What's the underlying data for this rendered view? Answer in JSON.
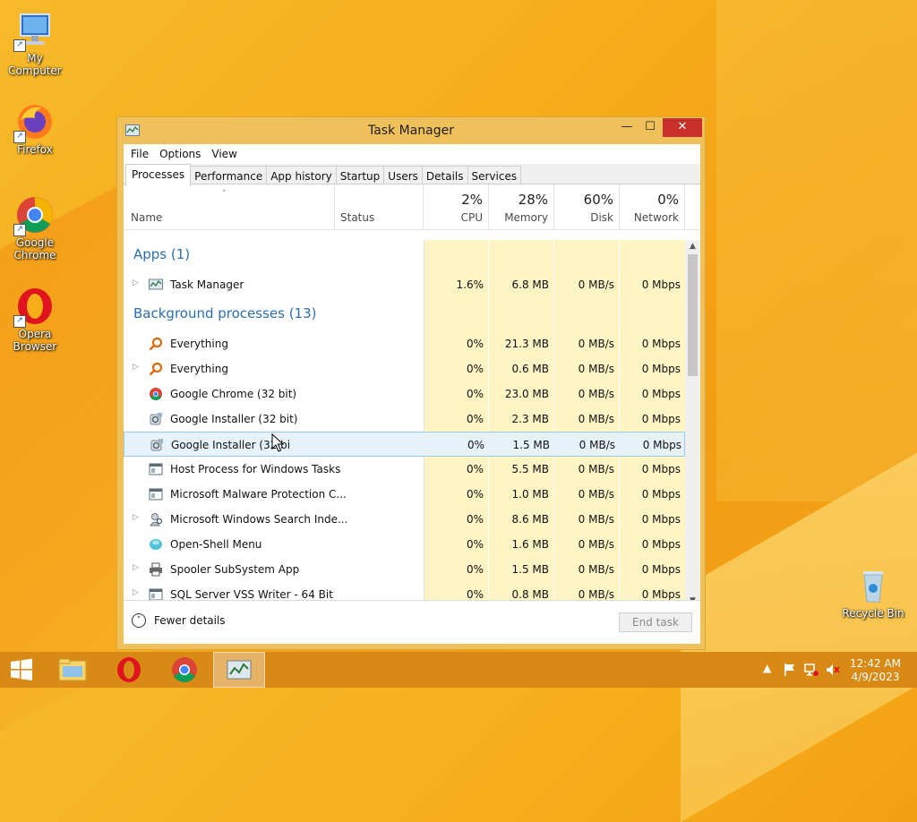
{
  "desktop": {
    "icons": [
      {
        "label": "My Computer"
      },
      {
        "label": "Firefox"
      },
      {
        "label": "Google Chrome"
      },
      {
        "label": "Opera Browser"
      },
      {
        "label": "Recycle Bin"
      }
    ]
  },
  "window": {
    "title": "Task Manager",
    "buttons": {
      "minimize": "—",
      "maximize": "☐",
      "close": "✕"
    },
    "menu": [
      "File",
      "Options",
      "View"
    ],
    "tabs": [
      "Processes",
      "Performance",
      "App history",
      "Startup",
      "Users",
      "Details",
      "Services"
    ],
    "active_tab": "Processes",
    "columns": {
      "name": "Name",
      "status": "Status",
      "cpu": {
        "pct": "2%",
        "label": "CPU"
      },
      "memory": {
        "pct": "28%",
        "label": "Memory"
      },
      "disk": {
        "pct": "60%",
        "label": "Disk"
      },
      "network": {
        "pct": "0%",
        "label": "Network"
      }
    },
    "groups": {
      "apps": "Apps (1)",
      "background": "Background processes (13)"
    },
    "apps": [
      {
        "name": "Task Manager",
        "cpu": "1.6%",
        "memory": "6.8 MB",
        "disk": "0 MB/s",
        "network": "0 Mbps",
        "expandable": true,
        "icon": "task-manager-icon"
      }
    ],
    "background": [
      {
        "name": "Everything",
        "cpu": "0%",
        "memory": "21.3 MB",
        "disk": "0 MB/s",
        "network": "0 Mbps",
        "expandable": false,
        "icon": "magnifier-icon"
      },
      {
        "name": "Everything",
        "cpu": "0%",
        "memory": "0.6 MB",
        "disk": "0 MB/s",
        "network": "0 Mbps",
        "expandable": true,
        "icon": "magnifier-icon"
      },
      {
        "name": "Google Chrome (32 bit)",
        "cpu": "0%",
        "memory": "23.0 MB",
        "disk": "0 MB/s",
        "network": "0 Mbps",
        "expandable": false,
        "icon": "chrome-icon"
      },
      {
        "name": "Google Installer (32 bit)",
        "cpu": "0%",
        "memory": "2.3 MB",
        "disk": "0 MB/s",
        "network": "0 Mbps",
        "expandable": false,
        "icon": "installer-icon"
      },
      {
        "name": "Google Installer (32 bi",
        "cpu": "0%",
        "memory": "1.5 MB",
        "disk": "0 MB/s",
        "network": "0 Mbps",
        "expandable": false,
        "icon": "installer-icon",
        "selected": true
      },
      {
        "name": "Host Process for Windows Tasks",
        "cpu": "0%",
        "memory": "5.5 MB",
        "disk": "0 MB/s",
        "network": "0 Mbps",
        "expandable": false,
        "icon": "window-app-icon"
      },
      {
        "name": "Microsoft Malware Protection C...",
        "cpu": "0%",
        "memory": "1.0 MB",
        "disk": "0 MB/s",
        "network": "0 Mbps",
        "expandable": false,
        "icon": "window-app-icon"
      },
      {
        "name": "Microsoft Windows Search Inde...",
        "cpu": "0%",
        "memory": "8.6 MB",
        "disk": "0 MB/s",
        "network": "0 Mbps",
        "expandable": true,
        "icon": "search-indexer-icon"
      },
      {
        "name": "Open-Shell Menu",
        "cpu": "0%",
        "memory": "1.6 MB",
        "disk": "0 MB/s",
        "network": "0 Mbps",
        "expandable": false,
        "icon": "shell-icon"
      },
      {
        "name": "Spooler SubSystem App",
        "cpu": "0%",
        "memory": "1.5 MB",
        "disk": "0 MB/s",
        "network": "0 Mbps",
        "expandable": true,
        "icon": "printer-icon"
      },
      {
        "name": "SQL Server VSS Writer - 64 Bit",
        "cpu": "0%",
        "memory": "0.8 MB",
        "disk": "0 MB/s",
        "network": "0 Mbps",
        "expandable": true,
        "icon": "window-app-icon"
      }
    ],
    "footer": {
      "fewer_details": "Fewer details",
      "end_task": "End task"
    }
  },
  "taskbar": {
    "clock_time": "12:42 AM",
    "clock_date": "4/9/2023",
    "tray_up_arrow": "▲"
  },
  "colors": {
    "accent": "#f6ad1a",
    "group_text": "#2a6db0",
    "close_button": "#c7312a",
    "data_band": "#fff4c4"
  }
}
